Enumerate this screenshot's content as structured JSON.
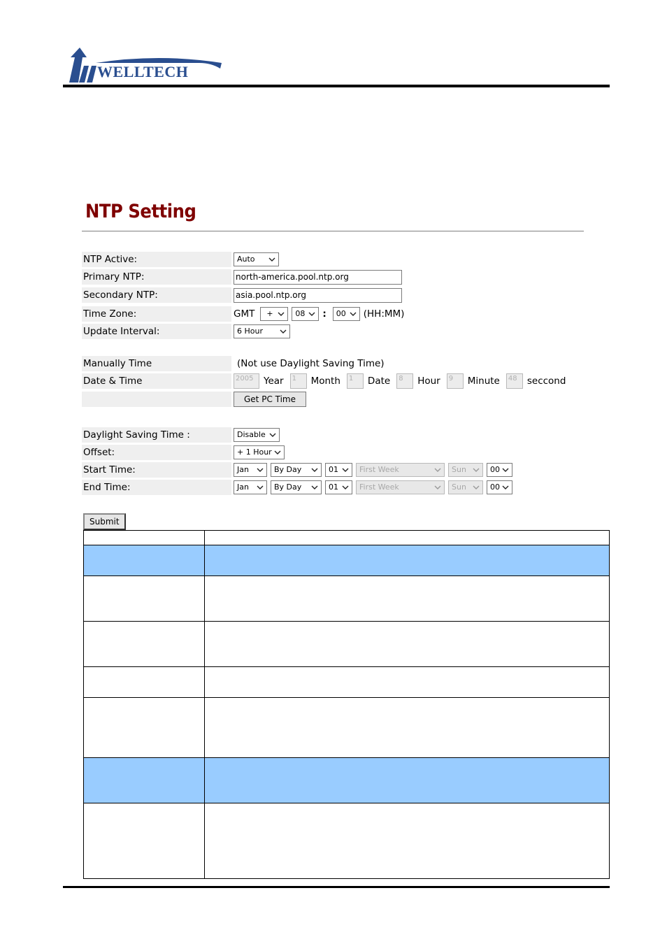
{
  "header": {
    "logo_text": "WELLTECH",
    "brand_color": "#2a4e8f"
  },
  "page": {
    "title": "NTP Setting",
    "title_color": "#7f0000"
  },
  "ntp": {
    "active": {
      "label": "NTP Active:",
      "value": "Auto"
    },
    "primary": {
      "label": "Primary NTP:",
      "value": "north-america.pool.ntp.org"
    },
    "secondary": {
      "label": "Secondary NTP:",
      "value": "asia.pool.ntp.org"
    },
    "timezone": {
      "label": "Time Zone:",
      "prefix": "GMT",
      "sign": "+",
      "hours": "08",
      "separator": ":",
      "minutes": "00",
      "format": "(HH:MM)"
    },
    "interval": {
      "label": "Update Interval:",
      "value": "6 Hour"
    }
  },
  "manual": {
    "label": "Manually Time",
    "note": "(Not use Daylight Saving Time)",
    "datetime_label": "Date & Time",
    "fields": [
      {
        "value": "2005",
        "unit": "Year"
      },
      {
        "value": "1",
        "unit": "Month"
      },
      {
        "value": "1",
        "unit": "Date"
      },
      {
        "value": "8",
        "unit": "Hour"
      },
      {
        "value": "9",
        "unit": "Minute"
      },
      {
        "value": "48",
        "unit": "seccond"
      }
    ],
    "get_pc_time": "Get PC Time"
  },
  "dst": {
    "mode": {
      "label": "Daylight Saving Time :",
      "value": "Disable"
    },
    "offset": {
      "label": "Offset:",
      "value": "+ 1 Hour"
    },
    "start": {
      "label": "Start Time:",
      "month": "Jan",
      "type": "By Day",
      "day": "01",
      "week": "First Week",
      "weekday": "Sun",
      "hour": "00"
    },
    "end": {
      "label": "End Time:",
      "month": "Jan",
      "type": "By Day",
      "day": "01",
      "week": "First Week",
      "weekday": "Sun",
      "hour": "00"
    }
  },
  "form": {
    "submit": "Submit"
  },
  "table": {
    "highlight_color": "#99ccff",
    "rows": [
      {
        "col1": "",
        "col2": "",
        "highlight": false
      },
      {
        "col1": "",
        "col2": "",
        "highlight": true
      },
      {
        "col1": "",
        "col2": "",
        "highlight": false
      },
      {
        "col1": "",
        "col2": "",
        "highlight": false
      },
      {
        "col1": "",
        "col2": "",
        "highlight": false
      },
      {
        "col1": "",
        "col2": "",
        "highlight": false
      },
      {
        "col1": "",
        "col2": "",
        "highlight": true
      },
      {
        "col1": "",
        "col2": "",
        "highlight": false
      }
    ]
  }
}
